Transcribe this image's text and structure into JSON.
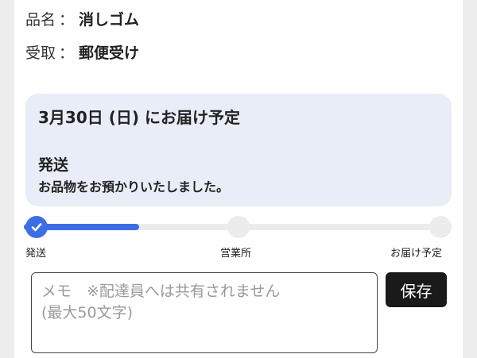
{
  "item": {
    "label": "品名",
    "separator": "：",
    "value": "消しゴム"
  },
  "receipt": {
    "label": "受取",
    "separator": "：",
    "value": "郵便受け"
  },
  "delivery": {
    "eta": "3月30日 (日) にお届け予定",
    "status_title": "発送",
    "status_message": "お品物をお預かりいたしました。"
  },
  "progress": {
    "fraction": 0.27,
    "accent_color": "#3d6ee6",
    "steps": [
      {
        "label": "発送",
        "done": true
      },
      {
        "label": "営業所",
        "done": false
      },
      {
        "label": "お届け予定",
        "done": false
      }
    ]
  },
  "memo": {
    "placeholder": "メモ　※配達員へは共有されません\n(最大50文字)",
    "value": ""
  },
  "save_button": {
    "label": "保存"
  },
  "icons": {
    "done_step": "check-icon"
  }
}
